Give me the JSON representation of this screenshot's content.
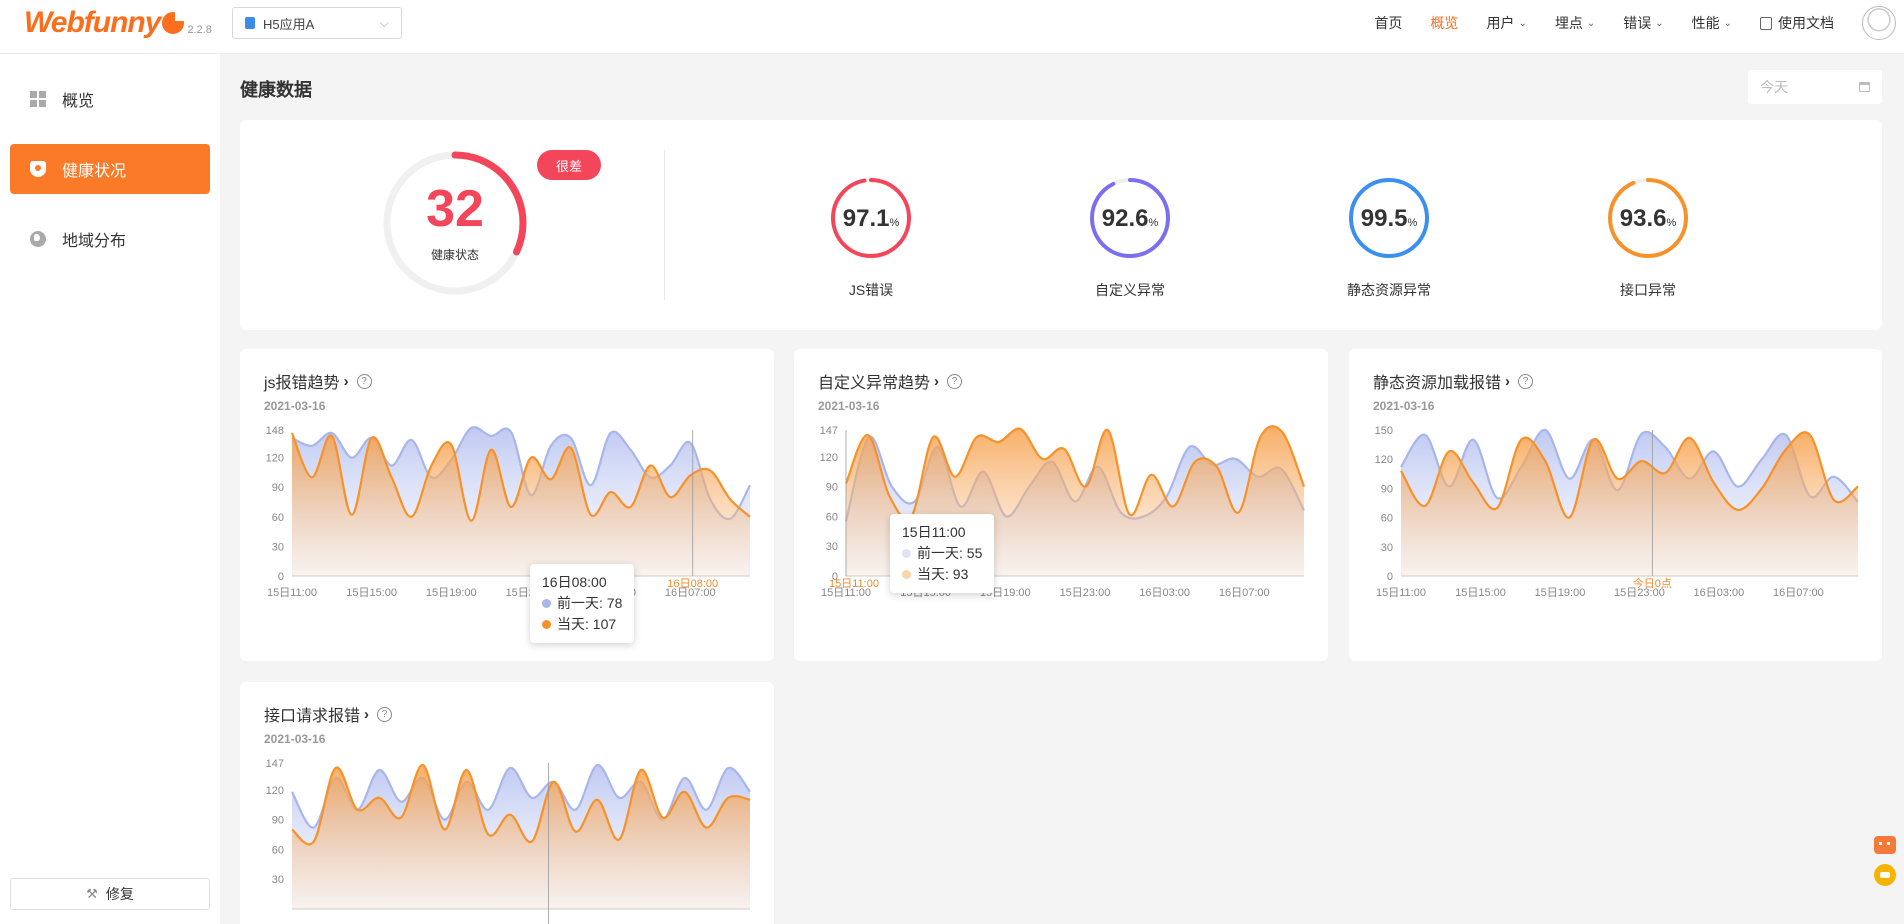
{
  "header": {
    "logo": "Webfunny",
    "version": "2.2.8",
    "app_select": "H5应用A",
    "nav": [
      {
        "label": "首页",
        "active": false,
        "caret": false
      },
      {
        "label": "概览",
        "active": true,
        "caret": false
      },
      {
        "label": "用户",
        "active": false,
        "caret": true
      },
      {
        "label": "埋点",
        "active": false,
        "caret": true
      },
      {
        "label": "错误",
        "active": false,
        "caret": true
      },
      {
        "label": "性能",
        "active": false,
        "caret": true
      }
    ],
    "doc_link": "使用文档"
  },
  "sidebar": {
    "items": [
      {
        "label": "概览",
        "icon": "grid-icon",
        "active": false
      },
      {
        "label": "健康状况",
        "icon": "shield-icon",
        "active": true
      },
      {
        "label": "地域分布",
        "icon": "globe-icon",
        "active": false
      }
    ],
    "repair_label": "修复"
  },
  "main": {
    "title": "健康数据",
    "date_placeholder": "今天"
  },
  "health": {
    "score": "32",
    "score_fraction": 0.32,
    "score_label": "健康状态",
    "badge": "很差",
    "colors": {
      "bad": "#f4465a",
      "js": "#f4465a",
      "custom": "#7b6ff0",
      "static": "#3a8ff0",
      "api": "#f7922a"
    },
    "gauges": [
      {
        "value": "97.1",
        "unit": "%",
        "label": "JS错误",
        "color": "#f4465a",
        "fraction": 0.971
      },
      {
        "value": "92.6",
        "unit": "%",
        "label": "自定义异常",
        "color": "#7b6ff0",
        "fraction": 0.926
      },
      {
        "value": "99.5",
        "unit": "%",
        "label": "静态资源异常",
        "color": "#3a8ff0",
        "fraction": 0.995
      },
      {
        "value": "93.6",
        "unit": "%",
        "label": "接口异常",
        "color": "#f7922a",
        "fraction": 0.936
      }
    ]
  },
  "series_names": {
    "prev": "前一天",
    "today": "当天"
  },
  "charts": [
    {
      "title": "js报错趋势",
      "date": "2021-03-16",
      "y_ticks": [
        "148",
        "120",
        "90",
        "60",
        "30",
        "0"
      ],
      "x_ticks": [
        "15日11:00",
        "15日15:00",
        "15日19:00",
        "15日23:00",
        "16日03:00",
        "16日07:00"
      ],
      "marker_label": "16日08:00",
      "tooltip": {
        "time": "16日08:00",
        "prev_label": "前一天: 78",
        "today_label": "当天: 107"
      }
    },
    {
      "title": "自定义异常趋势",
      "date": "2021-03-16",
      "y_ticks": [
        "147",
        "120",
        "90",
        "60",
        "30",
        "0"
      ],
      "x_ticks": [
        "15日11:00",
        "15日15:00",
        "15日19:00",
        "15日23:00",
        "16日03:00",
        "16日07:00"
      ],
      "marker_label": "15日11:00",
      "tooltip": {
        "time": "15日11:00",
        "prev_label": "前一天: 55",
        "today_label": "当天: 93"
      }
    },
    {
      "title": "静态资源加载报错",
      "date": "2021-03-16",
      "y_ticks": [
        "150",
        "120",
        "90",
        "60",
        "30",
        "0"
      ],
      "x_ticks": [
        "15日11:00",
        "15日15:00",
        "15日19:00",
        "15日23:00",
        "16日03:00",
        "16日07:00"
      ],
      "marker_label": "今日0点"
    },
    {
      "title": "接口请求报错",
      "date": "2021-03-16",
      "y_ticks": [
        "147",
        "120",
        "90",
        "60",
        "30"
      ],
      "x_ticks": []
    }
  ],
  "chart_data": [
    {
      "type": "area",
      "title": "js报错趋势",
      "ylim": [
        0,
        148
      ],
      "x": [
        "15日11:00",
        "15日15:00",
        "15日19:00",
        "15日23:00",
        "16日03:00",
        "16日07:00"
      ],
      "series": [
        {
          "name": "前一天",
          "color": "#a9b6ea",
          "values": [
            140,
            132,
            145,
            120,
            140,
            112,
            138,
            100,
            118,
            150,
            142,
            146,
            82,
            132,
            140,
            92,
            145,
            128,
            100,
            112,
            135,
            78,
            58,
            92
          ]
        },
        {
          "name": "当天",
          "color": "#f7922a",
          "values": [
            145,
            100,
            142,
            62,
            140,
            100,
            60,
            112,
            133,
            56,
            128,
            70,
            120,
            98,
            130,
            62,
            85,
            70,
            112,
            80,
            102,
            107,
            78,
            60
          ]
        }
      ]
    },
    {
      "type": "area",
      "title": "自定义异常趋势",
      "ylim": [
        0,
        147
      ],
      "x": [
        "15日11:00",
        "15日15:00",
        "15日19:00",
        "15日23:00",
        "16日03:00",
        "16日07:00"
      ],
      "series": [
        {
          "name": "前一天",
          "color": "#a9b6ea",
          "values": [
            55,
            140,
            90,
            75,
            130,
            70,
            105,
            60,
            90,
            115,
            75,
            110,
            64,
            60,
            80,
            130,
            112,
            118,
            100,
            108,
            66
          ]
        },
        {
          "name": "当天",
          "color": "#f7922a",
          "values": [
            93,
            142,
            80,
            60,
            140,
            100,
            140,
            135,
            148,
            118,
            128,
            90,
            147,
            62,
            102,
            70,
            115,
            110,
            64,
            140,
            145,
            90
          ]
        }
      ]
    },
    {
      "type": "area",
      "title": "静态资源加载报错",
      "ylim": [
        0,
        150
      ],
      "x": [
        "15日11:00",
        "15日15:00",
        "15日19:00",
        "15日23:00",
        "16日03:00",
        "16日07:00"
      ],
      "series": [
        {
          "name": "前一天",
          "color": "#a9b6ea",
          "values": [
            112,
            145,
            92,
            140,
            80,
            112,
            150,
            100,
            140,
            88,
            146,
            132,
            100,
            128,
            92,
            120,
            145,
            82,
            102,
            76
          ]
        },
        {
          "name": "当天",
          "color": "#f7922a",
          "values": [
            108,
            72,
            128,
            96,
            70,
            140,
            118,
            60,
            140,
            100,
            118,
            106,
            142,
            96,
            68,
            90,
            130,
            145,
            78,
            92
          ]
        }
      ]
    },
    {
      "type": "area",
      "title": "接口请求报错",
      "ylim": [
        0,
        147
      ],
      "x": [],
      "series": [
        {
          "name": "前一天",
          "color": "#a9b6ea",
          "values": [
            118,
            82,
            132,
            100,
            140,
            108,
            132,
            90,
            128,
            100,
            142,
            112,
            128,
            100,
            145,
            112,
            128,
            90,
            132,
            100,
            142,
            118
          ]
        },
        {
          "name": "当天",
          "color": "#f7922a",
          "values": [
            80,
            68,
            142,
            100,
            112,
            92,
            145,
            80,
            140,
            75,
            95,
            68,
            128,
            78,
            110,
            70,
            140,
            92,
            118,
            82,
            112,
            110
          ]
        }
      ]
    }
  ]
}
